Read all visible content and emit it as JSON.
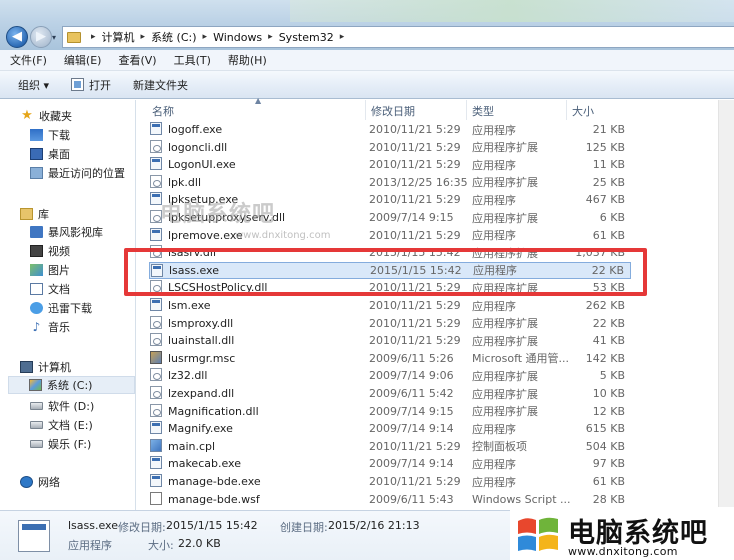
{
  "address": {
    "crumbs": [
      "计算机",
      "系统 (C:)",
      "Windows",
      "System32"
    ]
  },
  "menubar": [
    "文件(F)",
    "编辑(E)",
    "查看(V)",
    "工具(T)",
    "帮助(H)"
  ],
  "toolbar": {
    "organize": "组织 ▾",
    "open": "打开",
    "new_folder": "新建文件夹"
  },
  "nav": {
    "favorites": "收藏夹",
    "downloads": "下载",
    "desktop": "桌面",
    "recent": "最近访问的位置",
    "libraries": "库",
    "baofeng": "暴风影视库",
    "videos": "视频",
    "pictures": "图片",
    "documents": "文档",
    "thunder": "迅雷下载",
    "music": "音乐",
    "computer": "计算机",
    "drive_c": "系统 (C:)",
    "drive_d": "软件 (D:)",
    "drive_e": "文档 (E:)",
    "drive_f": "娱乐 (F:)",
    "network": "网络"
  },
  "columns": {
    "name": "名称",
    "date": "修改日期",
    "type": "类型",
    "size": "大小"
  },
  "files": [
    {
      "name": "logoff.exe",
      "date": "2010/11/21 5:29",
      "type": "应用程序",
      "size": "21 KB",
      "icon": "exe"
    },
    {
      "name": "logoncli.dll",
      "date": "2010/11/21 5:29",
      "type": "应用程序扩展",
      "size": "125 KB",
      "icon": "dll"
    },
    {
      "name": "LogonUI.exe",
      "date": "2010/11/21 5:29",
      "type": "应用程序",
      "size": "11 KB",
      "icon": "exe"
    },
    {
      "name": "lpk.dll",
      "date": "2013/12/25 16:35",
      "type": "应用程序扩展",
      "size": "25 KB",
      "icon": "dll"
    },
    {
      "name": "lpksetup.exe",
      "date": "2010/11/21 5:29",
      "type": "应用程序",
      "size": "467 KB",
      "icon": "exe"
    },
    {
      "name": "lpksetupproxyserv.dll",
      "date": "2009/7/14 9:15",
      "type": "应用程序扩展",
      "size": "6 KB",
      "icon": "dll"
    },
    {
      "name": "lpremove.exe",
      "date": "2010/11/21 5:29",
      "type": "应用程序",
      "size": "61 KB",
      "icon": "exe"
    },
    {
      "name": "lsasrv.dll",
      "date": "2015/1/15 15:42",
      "type": "应用程序扩展",
      "size": "1,037 KB",
      "icon": "dll"
    },
    {
      "name": "lsass.exe",
      "date": "2015/1/15 15:42",
      "type": "应用程序",
      "size": "22 KB",
      "icon": "exe",
      "selected": true
    },
    {
      "name": "LSCSHostPolicy.dll",
      "date": "2010/11/21 5:29",
      "type": "应用程序扩展",
      "size": "53 KB",
      "icon": "dll"
    },
    {
      "name": "lsm.exe",
      "date": "2010/11/21 5:29",
      "type": "应用程序",
      "size": "262 KB",
      "icon": "exe"
    },
    {
      "name": "lsmproxy.dll",
      "date": "2010/11/21 5:29",
      "type": "应用程序扩展",
      "size": "22 KB",
      "icon": "dll"
    },
    {
      "name": "luainstall.dll",
      "date": "2010/11/21 5:29",
      "type": "应用程序扩展",
      "size": "41 KB",
      "icon": "dll"
    },
    {
      "name": "lusrmgr.msc",
      "date": "2009/6/11 5:26",
      "type": "Microsoft 通用管...",
      "size": "142 KB",
      "icon": "msc"
    },
    {
      "name": "lz32.dll",
      "date": "2009/7/14 9:06",
      "type": "应用程序扩展",
      "size": "5 KB",
      "icon": "dll"
    },
    {
      "name": "lzexpand.dll",
      "date": "2009/6/11 5:42",
      "type": "应用程序扩展",
      "size": "10 KB",
      "icon": "dll"
    },
    {
      "name": "Magnification.dll",
      "date": "2009/7/14 9:15",
      "type": "应用程序扩展",
      "size": "12 KB",
      "icon": "dll"
    },
    {
      "name": "Magnify.exe",
      "date": "2009/7/14 9:14",
      "type": "应用程序",
      "size": "615 KB",
      "icon": "exe"
    },
    {
      "name": "main.cpl",
      "date": "2010/11/21 5:29",
      "type": "控制面板项",
      "size": "504 KB",
      "icon": "cpl"
    },
    {
      "name": "makecab.exe",
      "date": "2009/7/14 9:14",
      "type": "应用程序",
      "size": "97 KB",
      "icon": "exe"
    },
    {
      "name": "manage-bde.exe",
      "date": "2010/11/21 5:29",
      "type": "应用程序",
      "size": "61 KB",
      "icon": "exe"
    },
    {
      "name": "manage-bde.wsf",
      "date": "2009/6/11 5:43",
      "type": "Windows Script ...",
      "size": "28 KB",
      "icon": "wsf"
    }
  ],
  "details": {
    "filename": "lsass.exe",
    "filetype": "应用程序",
    "modified_label": "修改日期:",
    "modified_value": "2015/1/15 15:42",
    "created_label": "创建日期:",
    "created_value": "2015/2/16 21:13",
    "size_label": "大小:",
    "size_value": "22.0 KB"
  },
  "watermark": {
    "text": "电脑系统吧",
    "url": "www.dnxitong.com"
  },
  "brand": {
    "title": "电脑系统吧",
    "url": "www.dnxitong.com"
  },
  "colors": {
    "highlight": "#e53838",
    "selection": "#d9e8f9"
  }
}
